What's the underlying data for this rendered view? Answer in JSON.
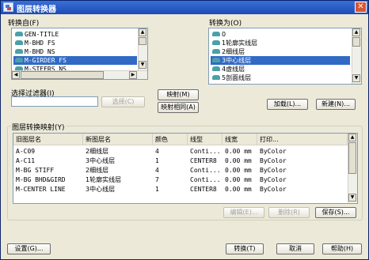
{
  "window": {
    "title": "图层转换器",
    "close_glyph": "✕"
  },
  "convert_from": {
    "label": "转换自(F)",
    "items": [
      "GEN-TITLE",
      "M-BHD FS",
      "M-BHD NS",
      "M-GIRDER FS",
      "M-STEERS NS"
    ],
    "selected_index": 3
  },
  "convert_to": {
    "label": "转换为(O)",
    "items": [
      "0",
      "1轮廓实线层",
      "2细线层",
      "3中心线层",
      "4虚线层",
      "5剖面线层"
    ],
    "selected_index": 3
  },
  "filter": {
    "label": "选择过滤器(I)",
    "value": "",
    "select_button": "选择(C)"
  },
  "map_buttons": {
    "map": "映射(M)",
    "map_same": "映射相同(A)"
  },
  "right_buttons": {
    "load": "加载(L)...",
    "new": "新建(N)..."
  },
  "mapping": {
    "label": "图层转换映射(Y)",
    "columns": [
      "旧图层名",
      "新图层名",
      "颜色",
      "线型",
      "线宽",
      "打印..."
    ],
    "rows": [
      [
        "A-C09",
        "2细线层",
        "4",
        "Conti...",
        "0.00 mm",
        "ByColor"
      ],
      [
        "A-C11",
        "3中心线层",
        "1",
        "CENTER8",
        "0.00 mm",
        "ByColor"
      ],
      [
        "M-BG STIFF",
        "2细线层",
        "4",
        "Conti...",
        "0.00 mm",
        "ByColor"
      ],
      [
        "M-BG BHD&GIRD",
        "1轮廓实线层",
        "7",
        "Conti...",
        "0.00 mm",
        "ByColor"
      ],
      [
        "M-CENTER LINE",
        "3中心线层",
        "1",
        "CENTER8",
        "0.00 mm",
        "ByColor"
      ]
    ],
    "edit_button": "编辑(E)...",
    "delete_button": "删除(R)",
    "save_button": "保存(S)..."
  },
  "footer": {
    "settings": "设置(G)...",
    "convert": "转换(T)",
    "cancel": "取消",
    "help": "帮助(H)"
  }
}
